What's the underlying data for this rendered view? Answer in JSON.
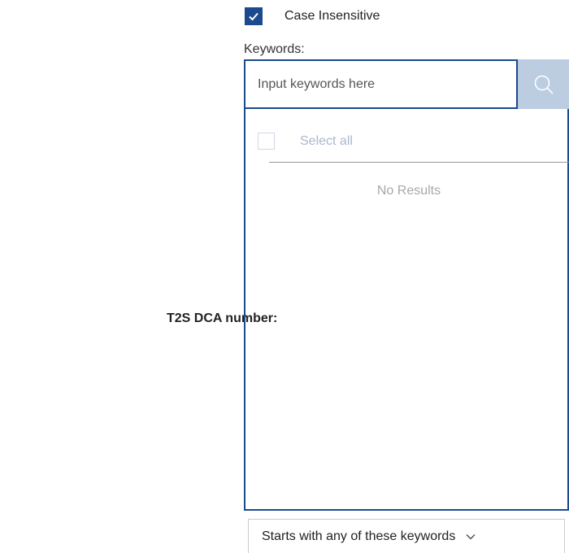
{
  "field": {
    "label": "T2S DCA number:"
  },
  "case_option": {
    "label": "Case Insensitive",
    "checked": true
  },
  "keywords": {
    "label": "Keywords:",
    "input_value": "",
    "placeholder": "Input keywords here",
    "search_icon": "search-icon"
  },
  "results": {
    "select_all_label": "Select all",
    "select_all_checked": false,
    "empty_message": "No Results"
  },
  "match_mode": {
    "selected": "Starts with any of these keywords",
    "icon": "chevron-down-icon"
  },
  "colors": {
    "accent": "#1b4a8f",
    "search_button_bg": "#bccce1",
    "disabled_text": "#a9b8cf",
    "muted_text": "#a8a8a8"
  }
}
